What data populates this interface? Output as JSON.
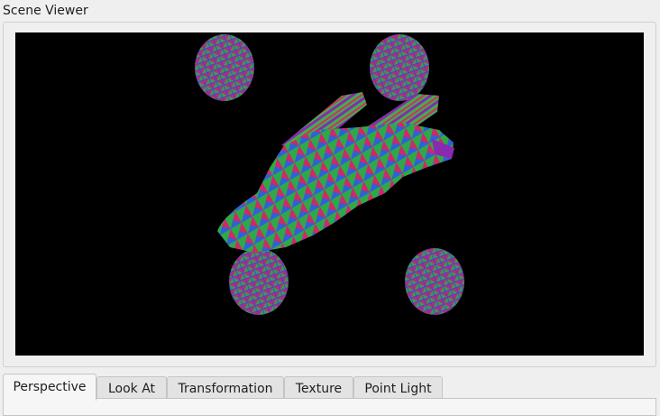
{
  "window": {
    "title": "Scene Viewer"
  },
  "viewer": {
    "background": "#000000"
  },
  "tabs": [
    {
      "label": "Perspective",
      "active": true
    },
    {
      "label": "Look At",
      "active": false
    },
    {
      "label": "Transformation",
      "active": false
    },
    {
      "label": "Texture",
      "active": false
    },
    {
      "label": "Point Light",
      "active": false
    }
  ]
}
